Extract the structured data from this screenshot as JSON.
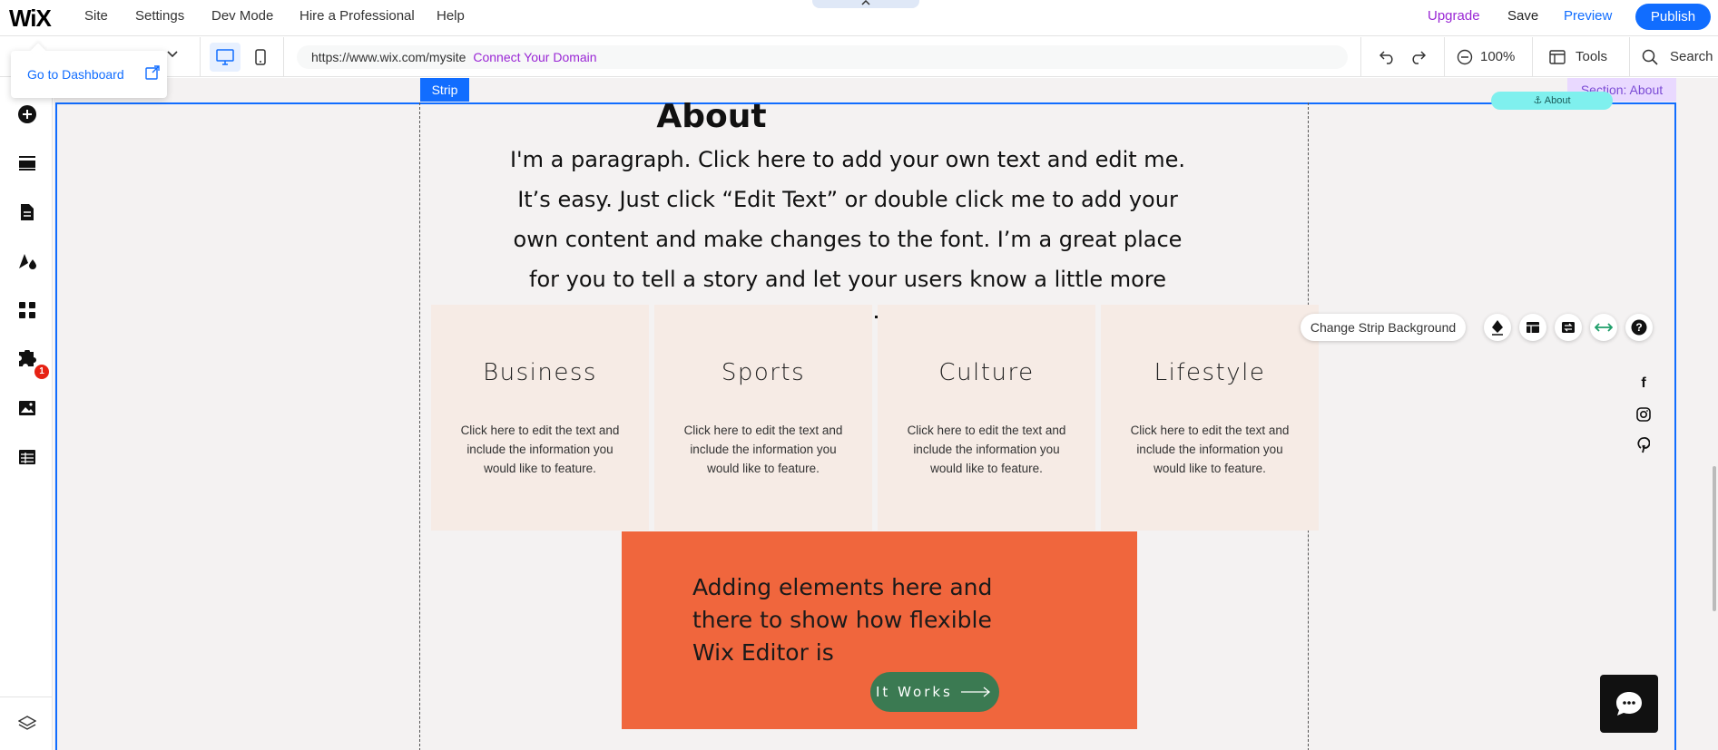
{
  "topbar": {
    "logo": "WiX",
    "menu": [
      "Site",
      "Settings",
      "Dev Mode",
      "Hire a Professional",
      "Help"
    ],
    "upgrade": "Upgrade",
    "save": "Save",
    "preview": "Preview",
    "publish": "Publish"
  },
  "toolbar": {
    "url": "https://www.wix.com/mysite",
    "connect_domain": "Connect Your Domain",
    "zoom": "100%",
    "tools": "Tools",
    "search": "Search"
  },
  "dashboard": {
    "label": "Go to Dashboard"
  },
  "sidebar": {
    "badge": "1"
  },
  "canvas": {
    "strip_tag": "Strip",
    "section_tag": "Section: About",
    "anchor_label": "About",
    "title": "About",
    "paragraph": "I'm a paragraph. Click here to add your own text and edit me. It’s easy. Just click “Edit Text” or double click me to add your own content and make changes to the font. I’m a great place for you to tell a story and let your users know a little more about",
    "cards": [
      {
        "title": "Business",
        "text": "Click here to edit the text and include the information you would like to feature."
      },
      {
        "title": "Sports",
        "text": "Click here to edit the text and include the information you would like to feature."
      },
      {
        "title": "Culture",
        "text": "Click here to edit the text and include the information you would like to feature."
      },
      {
        "title": "Lifestyle",
        "text": "Click here to edit the text and include the information you would like to feature."
      }
    ],
    "orange_text": "Adding elements here and there to show how flexible Wix Editor is",
    "works_button": "It Works",
    "change_strip_background": "Change Strip Background"
  },
  "colors": {
    "accent": "#116dff",
    "upgrade": "#9a27d5",
    "orange_box": "#f0663d",
    "card_bg": "#f6ebe5",
    "works_button": "#3b7a52"
  }
}
